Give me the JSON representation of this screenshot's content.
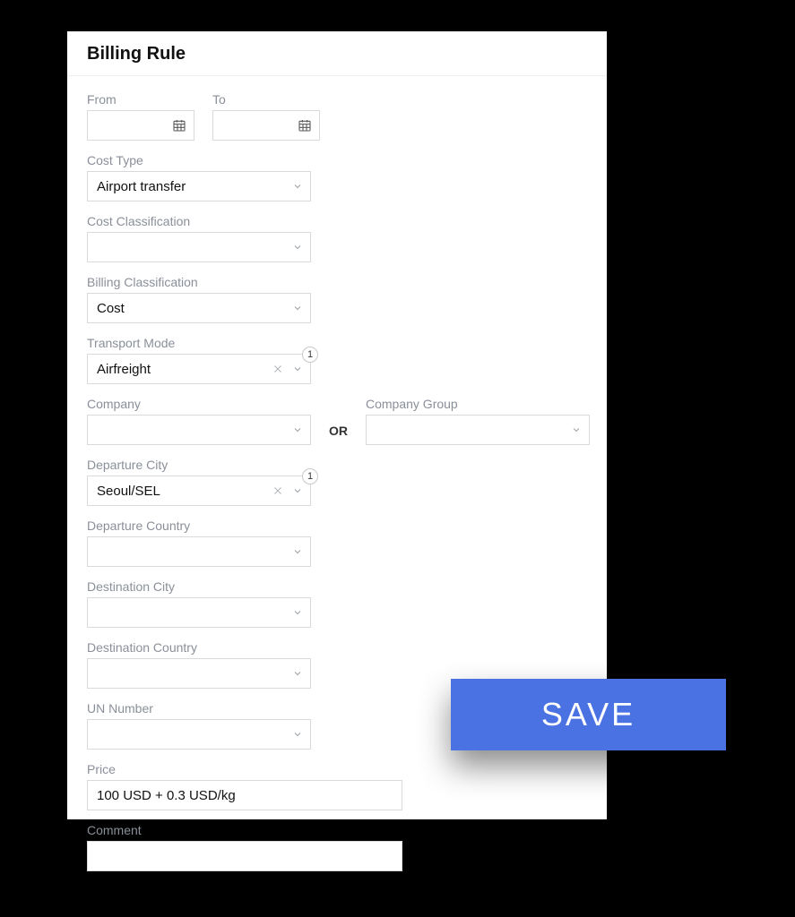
{
  "panel": {
    "title": "Billing Rule"
  },
  "fields": {
    "from": {
      "label": "From",
      "value": ""
    },
    "to": {
      "label": "To",
      "value": ""
    },
    "cost_type": {
      "label": "Cost Type",
      "value": "Airport transfer"
    },
    "cost_classification": {
      "label": "Cost Classification",
      "value": ""
    },
    "billing_classification": {
      "label": "Billing Classification",
      "value": "Cost"
    },
    "transport_mode": {
      "label": "Transport Mode",
      "value": "Airfreight",
      "count": "1"
    },
    "company": {
      "label": "Company",
      "value": ""
    },
    "company_group": {
      "label": "Company Group",
      "value": ""
    },
    "departure_city": {
      "label": "Departure City",
      "value": "Seoul/SEL",
      "count": "1"
    },
    "departure_country": {
      "label": "Departure Country",
      "value": ""
    },
    "destination_city": {
      "label": "Destination City",
      "value": ""
    },
    "destination_country": {
      "label": "Destination Country",
      "value": ""
    },
    "un_number": {
      "label": "UN Number",
      "value": ""
    },
    "price": {
      "label": "Price",
      "value": "100 USD + 0.3 USD/kg"
    },
    "comment": {
      "label": "Comment",
      "value": ""
    }
  },
  "separators": {
    "or": "OR"
  },
  "buttons": {
    "save": "SAVE"
  }
}
